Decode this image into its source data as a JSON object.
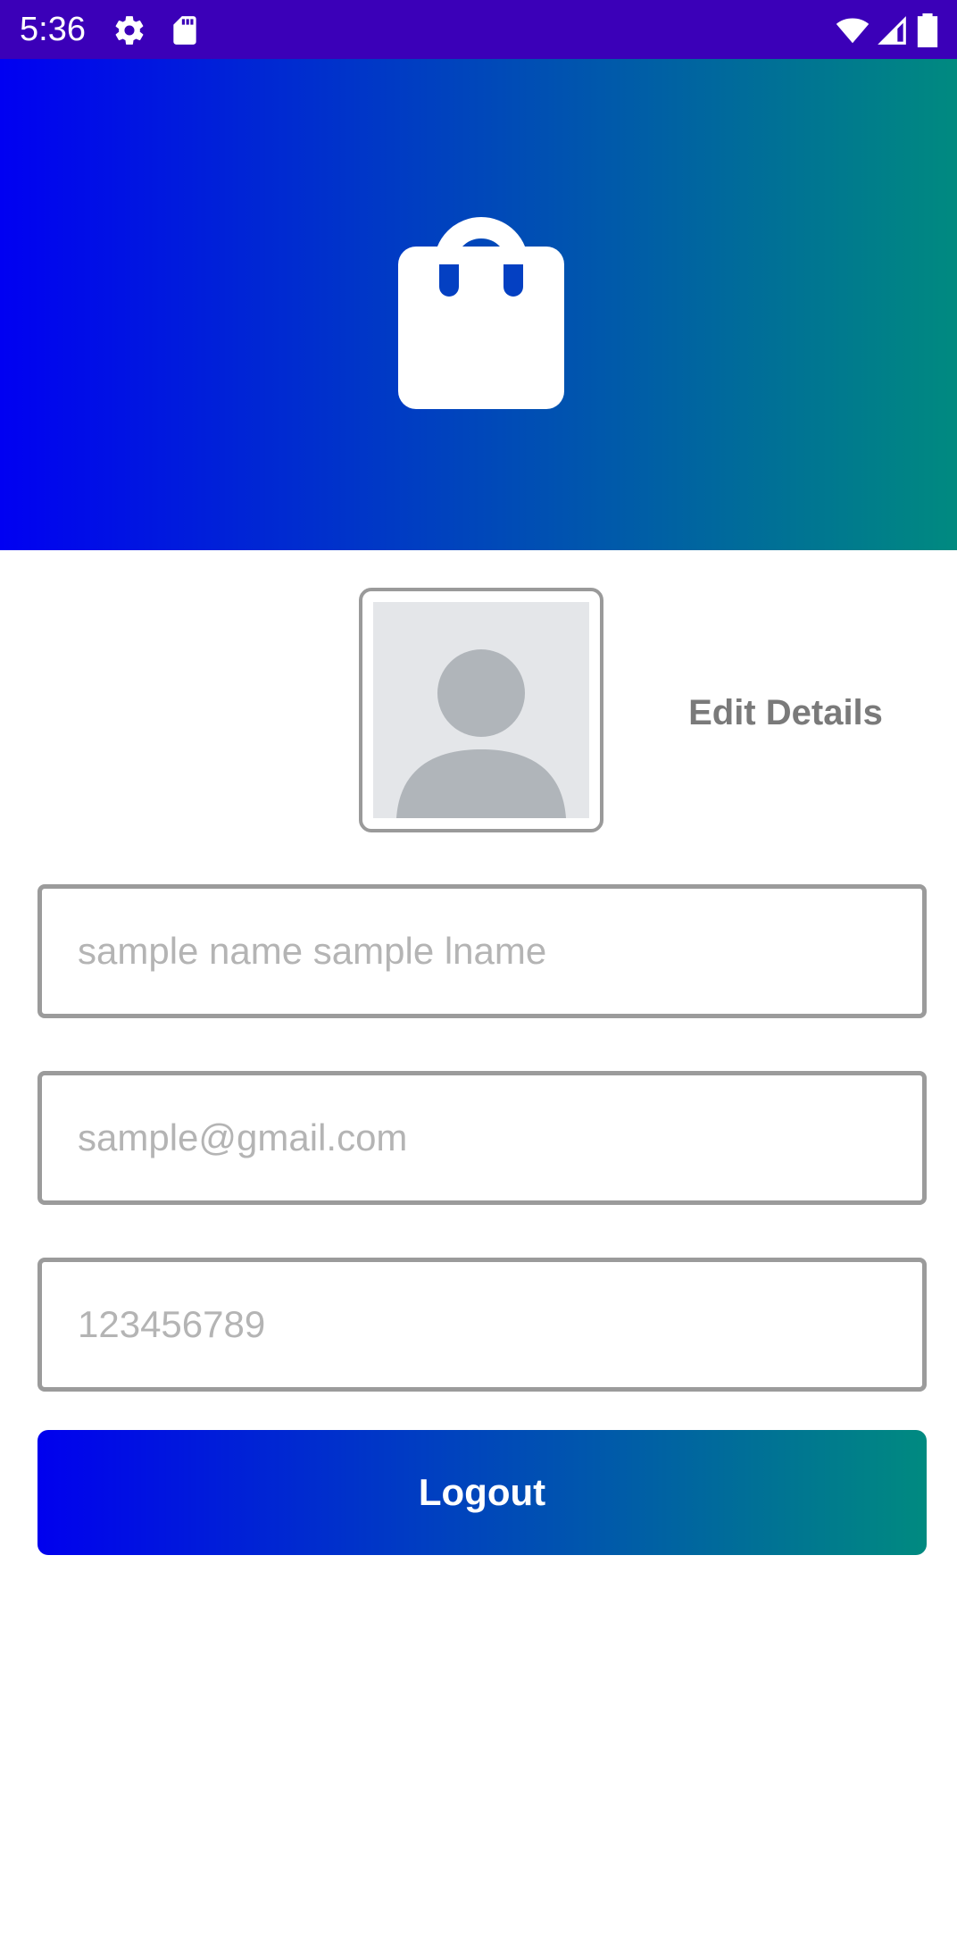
{
  "status_bar": {
    "time": "5:36",
    "icons": [
      "gear-icon",
      "sd-card-icon",
      "wifi-icon",
      "cell-signal-icon",
      "battery-icon"
    ]
  },
  "header": {
    "icon": "shopping-bag-icon",
    "gradient_colors": [
      "#0000f2",
      "#0040c0",
      "#008a80"
    ]
  },
  "profile": {
    "avatar_icon": "person-placeholder-icon",
    "edit_label": "Edit Details"
  },
  "form": {
    "name_placeholder": "sample name sample lname",
    "email_placeholder": "sample@gmail.com",
    "phone_placeholder": "123456789"
  },
  "logout_label": "Logout",
  "colors": {
    "status_bar": "#3b00b8",
    "field_border": "#9b9b9b",
    "placeholder_text": "#b4b4b4",
    "edit_text": "#7a7a7a"
  }
}
